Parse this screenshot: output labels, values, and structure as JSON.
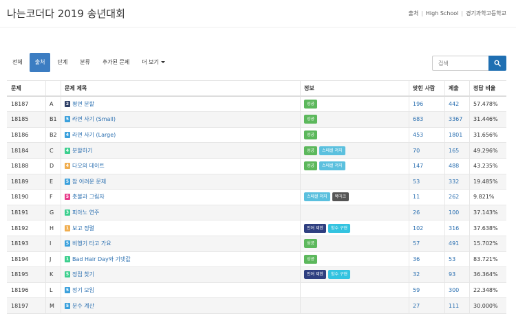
{
  "header": {
    "title": "나는코더다 2019 송년대회",
    "breadcrumb": [
      "출처",
      "High School",
      "경기과학고등학교"
    ]
  },
  "tabs": [
    {
      "label": "전체",
      "active": false
    },
    {
      "label": "출처",
      "active": true
    },
    {
      "label": "단계",
      "active": false
    },
    {
      "label": "분류",
      "active": false
    },
    {
      "label": "추가된 문제",
      "active": false
    },
    {
      "label": "더 보기",
      "active": false,
      "dropdown": true
    }
  ],
  "search": {
    "placeholder": "검색",
    "icon": "search-icon"
  },
  "table": {
    "columns": [
      "문제",
      "",
      "문제 제목",
      "정보",
      "맞힌 사람",
      "제출",
      "정답 비율"
    ],
    "rows": [
      {
        "id": "18187",
        "letter": "A",
        "tier": "2",
        "tier_color": "#2e3f66",
        "title": "평면 분할",
        "tags": [
          {
            "text": "성공",
            "color": "#5cb85c"
          }
        ],
        "solved": "196",
        "submissions": "442",
        "rate": "57.478%"
      },
      {
        "id": "18185",
        "letter": "B1",
        "tier": "5",
        "tier_color": "#3aa0dc",
        "title": "라면 사기 (Small)",
        "tags": [
          {
            "text": "성공",
            "color": "#5cb85c"
          }
        ],
        "solved": "683",
        "submissions": "3367",
        "rate": "31.446%"
      },
      {
        "id": "18186",
        "letter": "B2",
        "tier": "4",
        "tier_color": "#3aa0dc",
        "title": "라면 사기 (Large)",
        "tags": [
          {
            "text": "성공",
            "color": "#5cb85c"
          }
        ],
        "solved": "453",
        "submissions": "1801",
        "rate": "31.656%"
      },
      {
        "id": "18184",
        "letter": "C",
        "tier": "4",
        "tier_color": "#3ccf8e",
        "title": "분할하기",
        "tags": [
          {
            "text": "성공",
            "color": "#5cb85c"
          },
          {
            "text": "스페셜 저지",
            "color": "#5bc0de"
          }
        ],
        "solved": "70",
        "submissions": "165",
        "rate": "49.296%"
      },
      {
        "id": "18188",
        "letter": "D",
        "tier": "4",
        "tier_color": "#f0ad4e",
        "title": "다오의 데이트",
        "tags": [
          {
            "text": "성공",
            "color": "#5cb85c"
          },
          {
            "text": "스페셜 저지",
            "color": "#5bc0de"
          }
        ],
        "solved": "147",
        "submissions": "488",
        "rate": "43.235%"
      },
      {
        "id": "18189",
        "letter": "E",
        "tier": "5",
        "tier_color": "#3aa0dc",
        "title": "참 어려운 문제",
        "tags": [],
        "solved": "53",
        "submissions": "332",
        "rate": "19.485%"
      },
      {
        "id": "18190",
        "letter": "F",
        "tier": "5",
        "tier_color": "#e83e8c",
        "title": "촛불과 그림자",
        "tags": [
          {
            "text": "스페셜 저지",
            "color": "#5bc0de"
          },
          {
            "text": "북마크",
            "color": "#555555"
          }
        ],
        "solved": "11",
        "submissions": "262",
        "rate": "9.821%"
      },
      {
        "id": "18191",
        "letter": "G",
        "tier": "3",
        "tier_color": "#3ccf8e",
        "title": "피아노 연주",
        "tags": [],
        "solved": "26",
        "submissions": "100",
        "rate": "37.143%"
      },
      {
        "id": "18192",
        "letter": "H",
        "tier": "1",
        "tier_color": "#f0ad4e",
        "title": "보고 정렬",
        "tags": [
          {
            "text": "언어 제한",
            "color": "#2e3f80"
          },
          {
            "text": "함수 구현",
            "color": "#33c3e0"
          }
        ],
        "solved": "102",
        "submissions": "316",
        "rate": "37.638%"
      },
      {
        "id": "18193",
        "letter": "I",
        "tier": "5",
        "tier_color": "#3aa0dc",
        "title": "비행기 타고 가요",
        "tags": [
          {
            "text": "성공",
            "color": "#5cb85c"
          }
        ],
        "solved": "57",
        "submissions": "491",
        "rate": "15.702%"
      },
      {
        "id": "18194",
        "letter": "J",
        "tier": "1",
        "tier_color": "#3ccf8e",
        "title": "Bad Hair Day와 기댓값",
        "tags": [
          {
            "text": "성공",
            "color": "#5cb85c"
          }
        ],
        "solved": "36",
        "submissions": "53",
        "rate": "83.721%"
      },
      {
        "id": "18195",
        "letter": "K",
        "tier": "5",
        "tier_color": "#3ccf8e",
        "title": "정점 찾기",
        "tags": [
          {
            "text": "언어 제한",
            "color": "#2e3f80"
          },
          {
            "text": "함수 구현",
            "color": "#33c3e0"
          }
        ],
        "solved": "32",
        "submissions": "93",
        "rate": "36.364%"
      },
      {
        "id": "18196",
        "letter": "L",
        "tier": "5",
        "tier_color": "#3aa0dc",
        "title": "정기 모임",
        "tags": [],
        "solved": "59",
        "submissions": "300",
        "rate": "22.348%"
      },
      {
        "id": "18197",
        "letter": "M",
        "tier": "5",
        "tier_color": "#3aa0dc",
        "title": "분수 계산",
        "tags": [],
        "solved": "27",
        "submissions": "111",
        "rate": "30.000%"
      }
    ]
  }
}
